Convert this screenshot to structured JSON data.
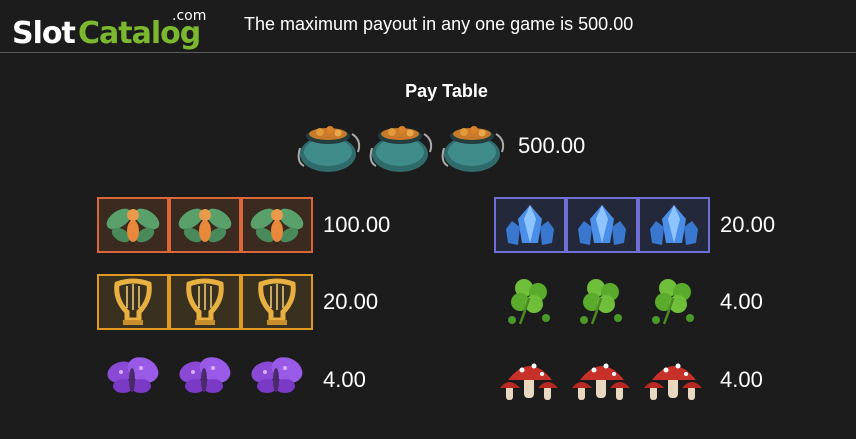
{
  "header": {
    "logo": {
      "slot": "Slot",
      "catalog": "Catalog",
      "com": ".com"
    },
    "max_payout_text": "The maximum payout in any one game is 500.00"
  },
  "paytable": {
    "title": "Pay Table",
    "rows": [
      {
        "symbol": "pot-of-gold-icon",
        "count": 3,
        "payout": "500.00"
      },
      {
        "symbol": "fairy-icon",
        "count": 3,
        "payout": "100.00",
        "frame_color": "#d9673a"
      },
      {
        "symbol": "blue-crystal-icon",
        "count": 3,
        "payout": "20.00",
        "frame_color": "#6f6fd6"
      },
      {
        "symbol": "golden-harp-icon",
        "count": 3,
        "payout": "20.00",
        "frame_color": "#e09a22"
      },
      {
        "symbol": "clover-icon",
        "count": 3,
        "payout": "4.00"
      },
      {
        "symbol": "purple-butterfly-icon",
        "count": 3,
        "payout": "4.00"
      },
      {
        "symbol": "red-mushroom-icon",
        "count": 3,
        "payout": "4.00"
      }
    ]
  },
  "colors": {
    "background": "#1c1c1c",
    "logo_green": "#7cb82f",
    "text": "#ffffff"
  }
}
